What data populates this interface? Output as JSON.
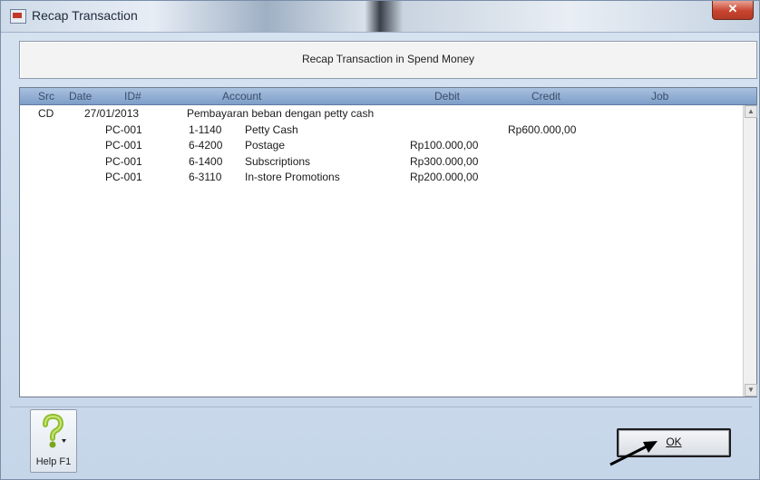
{
  "window": {
    "title": "Recap Transaction",
    "close_glyph": "✕"
  },
  "header": {
    "title": "Recap Transaction in Spend Money"
  },
  "grid": {
    "columns": [
      "Src",
      "Date",
      "ID#",
      "Account",
      "Debit",
      "Credit",
      "Job"
    ],
    "rows": [
      {
        "src": "CD",
        "date": "27/01/2013",
        "id": "",
        "account_no": "Pembayaran beban dengan petty cash",
        "account_name": "",
        "debit": "",
        "credit": ""
      },
      {
        "src": "",
        "date": "",
        "id": "PC-001",
        "account_no": "1-1140",
        "account_name": "Petty Cash",
        "debit": "",
        "credit": "Rp600.000,00"
      },
      {
        "src": "",
        "date": "",
        "id": "PC-001",
        "account_no": "6-4200",
        "account_name": "Postage",
        "debit": "Rp100.000,00",
        "credit": ""
      },
      {
        "src": "",
        "date": "",
        "id": "PC-001",
        "account_no": "6-1400",
        "account_name": "Subscriptions",
        "debit": "Rp300.000,00",
        "credit": ""
      },
      {
        "src": "",
        "date": "",
        "id": "PC-001",
        "account_no": "6-3110",
        "account_name": "In-store Promotions",
        "debit": "Rp200.000,00",
        "credit": ""
      }
    ]
  },
  "buttons": {
    "help_label": "Help F1",
    "help_icon": "help-question-icon",
    "ok_label": "OK"
  },
  "icons": {
    "scroll_up": "▲",
    "scroll_down": "▼"
  }
}
